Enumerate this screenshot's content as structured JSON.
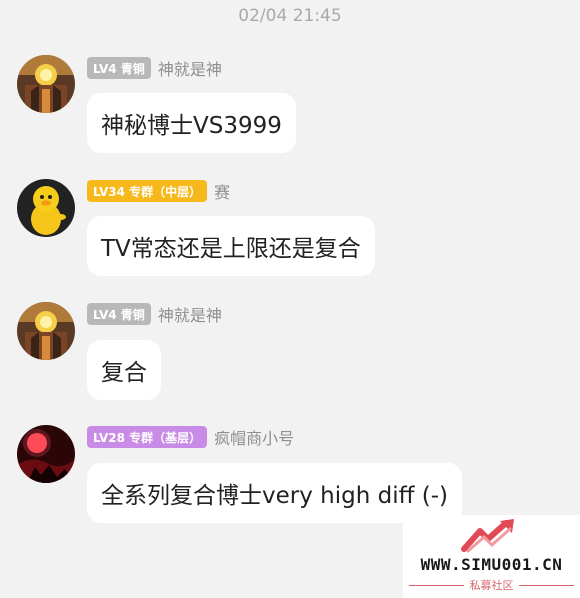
{
  "timestamp": "02/04 21:45",
  "messages": [
    {
      "badge": "LV4 青铜",
      "badge_color": "#b8b8b8",
      "nickname": "神就是神",
      "text": "神秘博士VS3999",
      "avatar": "golden-helmet-avatar"
    },
    {
      "badge": "LV34 专群（中层）",
      "badge_color": "#f7b81c",
      "nickname": "赛",
      "text": "TV常态还是上限还是复合",
      "avatar": "yellow-duck-avatar"
    },
    {
      "badge": "LV4 青铜",
      "badge_color": "#b8b8b8",
      "nickname": "神就是神",
      "text": "复合",
      "avatar": "golden-helmet-avatar"
    },
    {
      "badge": "LV28 专群（基层）",
      "badge_color": "#c98ce6",
      "nickname": "疯帽商小号",
      "text": "全系列复合博士very high diff (-)",
      "avatar": "red-moon-avatar"
    }
  ],
  "watermark": {
    "site": "WWW.SIMU001.CN",
    "tagline": "私募社区",
    "logo": "red-arrow-logo",
    "color": "#d8646b"
  }
}
